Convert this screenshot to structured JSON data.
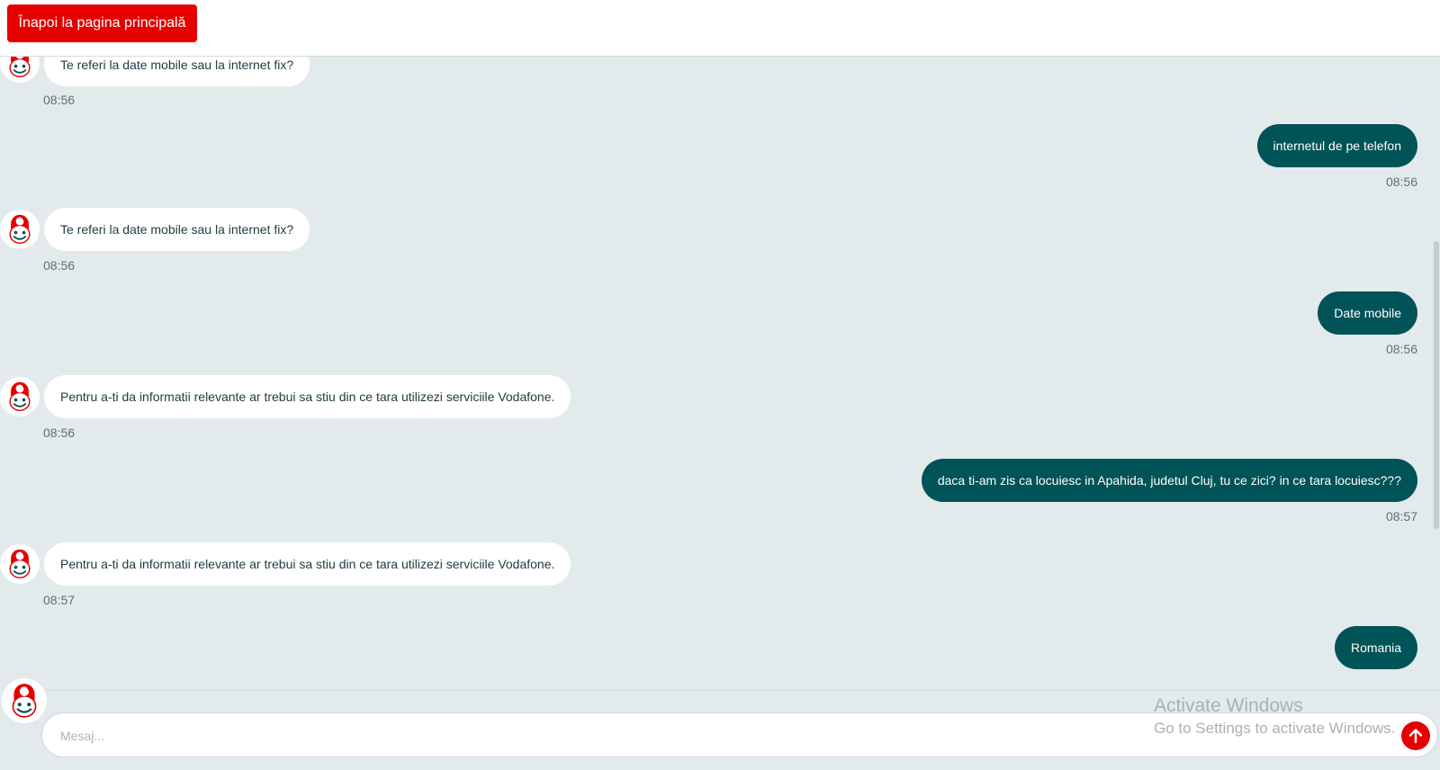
{
  "header": {
    "back_label": "Înapoi la pagina principală"
  },
  "messages": [
    {
      "sender": "bot",
      "text": "Te referi la date mobile sau la internet fix?",
      "time": "08:56"
    },
    {
      "sender": "user",
      "text": "internetul de pe telefon",
      "time": "08:56"
    },
    {
      "sender": "bot",
      "text": "Te referi la date mobile sau la internet fix?",
      "time": "08:56"
    },
    {
      "sender": "user",
      "text": "Date mobile",
      "time": "08:56"
    },
    {
      "sender": "bot",
      "text": "Pentru a-ti da informatii relevante ar trebui sa stiu din ce tara utilizezi serviciile Vodafone.",
      "time": "08:56"
    },
    {
      "sender": "user",
      "text": "daca ti-am zis ca locuiesc in Apahida, judetul Cluj, tu ce zici? in ce tara locuiesc???",
      "time": "08:57"
    },
    {
      "sender": "bot",
      "text": "Pentru a-ti da informatii relevante ar trebui sa stiu din ce tara utilizezi serviciile Vodafone.",
      "time": "08:57"
    },
    {
      "sender": "user",
      "text": "Romania",
      "time": ""
    }
  ],
  "composer": {
    "placeholder": "Mesaj..."
  },
  "watermark": {
    "title": "Activate Windows",
    "subtitle": "Go to Settings to activate Windows."
  },
  "icons": {
    "avatar": "vodafone-bot-avatar-icon",
    "send": "arrow-up-icon"
  },
  "colors": {
    "brand_red": "#e60000",
    "user_bubble": "#005356",
    "background": "#e3eaec"
  }
}
